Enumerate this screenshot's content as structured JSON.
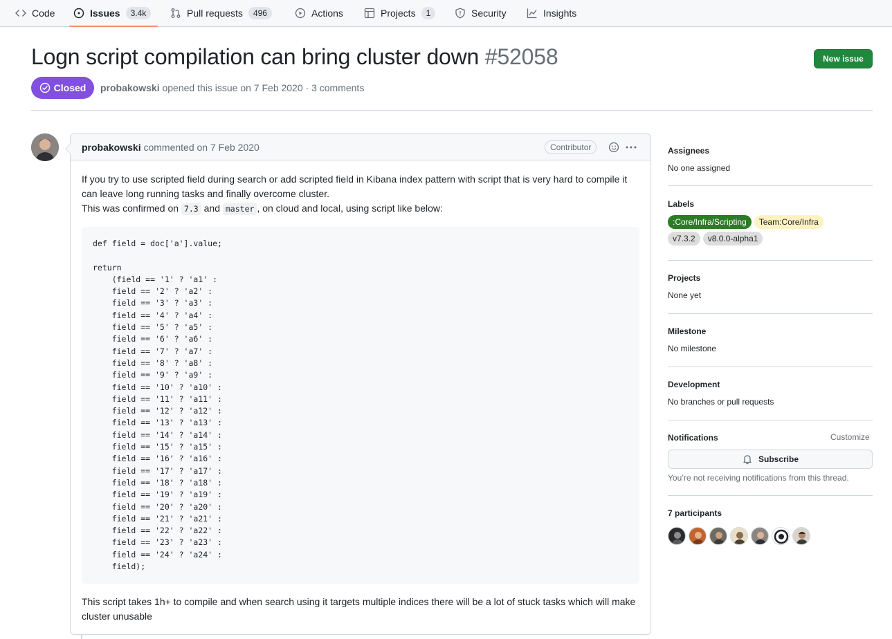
{
  "nav": {
    "code": "Code",
    "issues": "Issues",
    "issues_count": "3.4k",
    "pulls": "Pull requests",
    "pulls_count": "496",
    "actions": "Actions",
    "projects": "Projects",
    "projects_count": "1",
    "security": "Security",
    "insights": "Insights"
  },
  "issue": {
    "title": "Logn script compilation can bring cluster down",
    "number": "#52058",
    "state": "Closed",
    "author": "probakowski",
    "opened_text": " opened this issue on 7 Feb 2020 · 3 comments",
    "new_issue_label": "New issue"
  },
  "comment": {
    "author": "probakowski",
    "commented_text": " commented on 7 Feb 2020",
    "badge": "Contributor",
    "para1": "If you try to use scripted field during search or add scripted field in Kibana index pattern with script that is very hard to compile it can leave long running tasks and finally overcome cluster.",
    "para2_prefix": "This was confirmed on ",
    "code1": "7.3",
    "para2_mid": " and ",
    "code2": "master",
    "para2_suffix": ", on cloud and local, using script like below:",
    "code_block": "def field = doc['a'].value;\n\nreturn\n    (field == '1' ? 'a1' :\n    field == '2' ? 'a2' :\n    field == '3' ? 'a3' :\n    field == '4' ? 'a4' :\n    field == '5' ? 'a5' :\n    field == '6' ? 'a6' :\n    field == '7' ? 'a7' :\n    field == '8' ? 'a8' :\n    field == '9' ? 'a9' :\n    field == '10' ? 'a10' :\n    field == '11' ? 'a11' :\n    field == '12' ? 'a12' :\n    field == '13' ? 'a13' :\n    field == '14' ? 'a14' :\n    field == '15' ? 'a15' :\n    field == '16' ? 'a16' :\n    field == '17' ? 'a17' :\n    field == '18' ? 'a18' :\n    field == '19' ? 'a19' :\n    field == '20' ? 'a20' :\n    field == '21' ? 'a21' :\n    field == '22' ? 'a22' :\n    field == '23' ? 'a23' :\n    field == '24' ? 'a24' :\n    field);",
    "para3": "This script takes 1h+ to compile and when search using it targets multiple indices there will be a lot of stuck tasks which will make cluster unusable"
  },
  "sidebar": {
    "assignees_title": "Assignees",
    "assignees_value": "No one assigned",
    "labels_title": "Labels",
    "labels": [
      {
        "text": ":Core/Infra/Scripting",
        "bg": "#2a7d22",
        "fg": "#ffffff"
      },
      {
        "text": "Team:Core/Infra",
        "bg": "#fef2c0",
        "fg": "#1f2328"
      },
      {
        "text": "v7.3.2",
        "bg": "#dddddd",
        "fg": "#1f2328"
      },
      {
        "text": "v8.0.0-alpha1",
        "bg": "#dddddd",
        "fg": "#1f2328"
      }
    ],
    "projects_title": "Projects",
    "projects_value": "None yet",
    "milestone_title": "Milestone",
    "milestone_value": "No milestone",
    "development_title": "Development",
    "development_value": "No branches or pull requests",
    "notifications_title": "Notifications",
    "customize": "Customize",
    "subscribe": "Subscribe",
    "notif_note": "You’re not receiving notifications from this thread.",
    "participants_title": "7 participants"
  },
  "colors": {
    "closed": "#8250df",
    "new_issue": "#1f883d",
    "active_tab": "#fd8c73"
  }
}
